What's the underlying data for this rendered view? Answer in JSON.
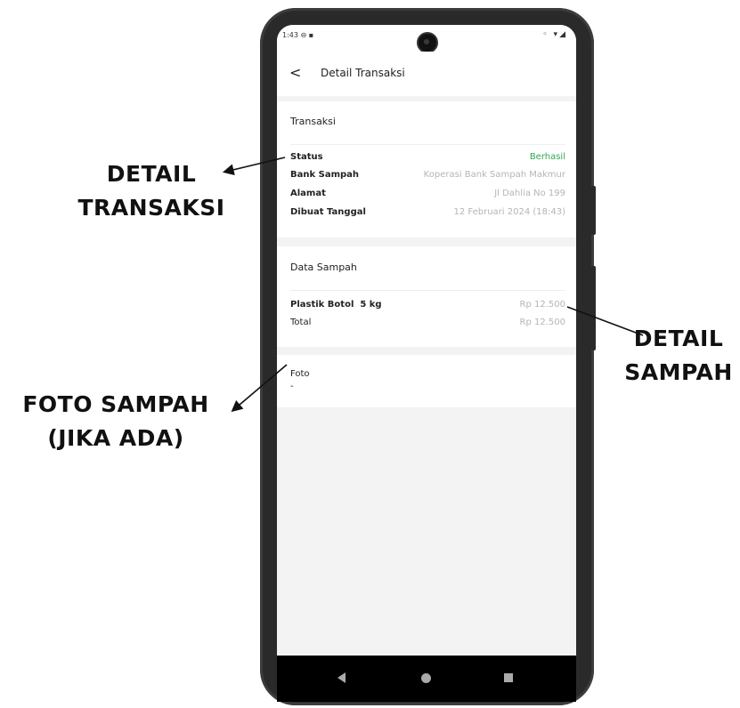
{
  "annotations": {
    "detail_transaksi": [
      "DETAIL",
      "TRANSAKSI"
    ],
    "foto_sampah": [
      "FOTO SAMPAH",
      "(JIKA ADA)"
    ],
    "detail_sampah": [
      "DETAIL",
      "SAMPAH"
    ]
  },
  "statusbar": {
    "time": "1:43",
    "left_icons": "⊖ ▪",
    "right_icons": "◦ ▾◢"
  },
  "appbar": {
    "back_glyph": "<",
    "title": "Detail Transaksi"
  },
  "transaksi": {
    "title": "Transaksi",
    "rows": [
      {
        "label": "Status",
        "value": "Berhasil"
      },
      {
        "label": "Bank Sampah",
        "value": "Koperasi Bank Sampah Makmur"
      },
      {
        "label": "Alamat",
        "value": "Jl Dahlia No 199"
      },
      {
        "label": "Dibuat Tanggal",
        "value": "12 Februari 2024 (18:43)"
      }
    ]
  },
  "data_sampah": {
    "title": "Data Sampah",
    "item_label": "Plastik Botol",
    "item_qty": "5 kg",
    "item_price": "Rp 12.500",
    "total_label": "Total",
    "total_value": "Rp 12.500"
  },
  "foto": {
    "title": "Foto",
    "value": "-"
  },
  "colors": {
    "success": "#2fa84f",
    "muted": "#b5b5b5",
    "background": "#f3f3f3"
  },
  "navbar": {
    "icons": [
      "nav-back-icon",
      "nav-home-icon",
      "nav-recents-icon"
    ]
  }
}
